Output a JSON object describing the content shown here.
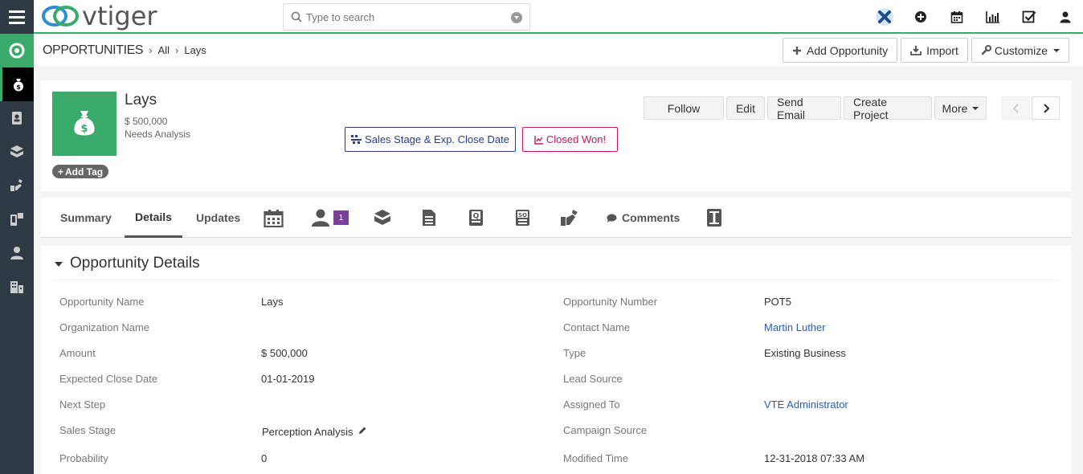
{
  "app": {
    "logo_text": "vtiger"
  },
  "search": {
    "placeholder": "Type to search"
  },
  "breadcrumb": {
    "module": "OPPORTUNITIES",
    "filter": "All",
    "record": "Lays"
  },
  "header_buttons": {
    "add": "Add Opportunity",
    "import": "Import",
    "customize": "Customize"
  },
  "record": {
    "name": "Lays",
    "amount": "$ 500,000",
    "stage": "Needs Analysis",
    "add_tag": "Add Tag",
    "stage_button": "Sales Stage & Exp. Close Date",
    "won_button": "Closed Won!",
    "actions": {
      "follow": "Follow",
      "edit": "Edit",
      "send_email": "Send Email",
      "create_project": "Create Project",
      "more": "More"
    }
  },
  "tabs": {
    "summary": "Summary",
    "details": "Details",
    "updates": "Updates",
    "contacts_count": "1",
    "comments": "Comments"
  },
  "details": {
    "section_title": "Opportunity Details",
    "left": [
      {
        "label": "Opportunity Name",
        "value": "Lays"
      },
      {
        "label": "Organization Name",
        "value": ""
      },
      {
        "label": "Amount",
        "value": "$ 500,000"
      },
      {
        "label": "Expected Close Date",
        "value": "01-01-2019"
      },
      {
        "label": "Next Step",
        "value": ""
      },
      {
        "label": "Sales Stage",
        "value": "Perception Analysis"
      },
      {
        "label": "Probability",
        "value": "0"
      }
    ],
    "right": [
      {
        "label": "Opportunity Number",
        "value": "POT5"
      },
      {
        "label": "Contact Name",
        "value": "Martin Luther"
      },
      {
        "label": "Type",
        "value": "Existing Business"
      },
      {
        "label": "Lead Source",
        "value": ""
      },
      {
        "label": "Assigned To",
        "value": "VTE Administrator"
      },
      {
        "label": "Campaign Source",
        "value": ""
      },
      {
        "label": "Modified Time",
        "value": "12-31-2018 07:33 AM"
      }
    ]
  },
  "colors": {
    "accent_green": "#3aaa6b",
    "rail_bg": "#2f3a45",
    "link_blue": "#2a5db0",
    "stage_blue": "#2b3c8c",
    "won_pink": "#c2185b",
    "badge_purple": "#7b3fa0"
  }
}
